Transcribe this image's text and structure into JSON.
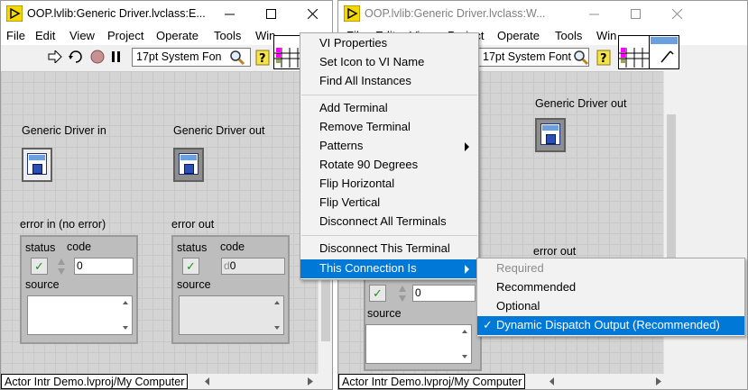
{
  "left_window": {
    "title": "OOP.lvlib:Generic Driver.lvclass:E...",
    "menu": [
      "File",
      "Edit",
      "View",
      "Project",
      "Operate",
      "Tools",
      "Win"
    ],
    "font_select": "17pt System Fon",
    "controls": {
      "in_label": "Generic Driver in",
      "out_label": "Generic Driver out",
      "error_in_label": "error in (no error)",
      "error_out_label": "error out",
      "status_label": "status",
      "code_label": "code",
      "source_label": "source",
      "code_in_value": "0",
      "code_out_value": "0",
      "code_out_radix": "d"
    },
    "status_path": "Actor Intr Demo.lvproj/My Computer"
  },
  "right_window": {
    "title": "OOP.lvlib:Generic Driver.lvclass:W...",
    "menu_visible": [
      "File",
      "Edit",
      "View",
      "Project"
    ],
    "menu_right": [
      "Operate",
      "Tools",
      "Win"
    ],
    "font_select": "17pt System Font",
    "controls": {
      "out_label": "Generic Driver out",
      "error_out_label": "error out",
      "source_label": "source",
      "code_value": "0"
    },
    "status_path": "Actor Intr Demo.lvproj/My Computer"
  },
  "context_menu": {
    "groups": [
      [
        "VI Properties",
        "Set Icon to VI Name",
        "Find All Instances"
      ],
      [
        "Add Terminal",
        "Remove Terminal",
        "Patterns",
        "Rotate 90 Degrees",
        "Flip Horizontal",
        "Flip Vertical",
        "Disconnect All Terminals"
      ],
      [
        "Disconnect This Terminal",
        "This Connection Is"
      ]
    ]
  },
  "submenu": {
    "items": [
      "Required",
      "Recommended",
      "Optional",
      "Dynamic Dispatch Output (Recommended)"
    ],
    "disabled_index": 0,
    "checked_index": 3
  },
  "colors": {
    "menu_highlight": "#0078d7",
    "panel_grid": "#d4d4d4",
    "status_ok_green": "#1f8f1f"
  }
}
